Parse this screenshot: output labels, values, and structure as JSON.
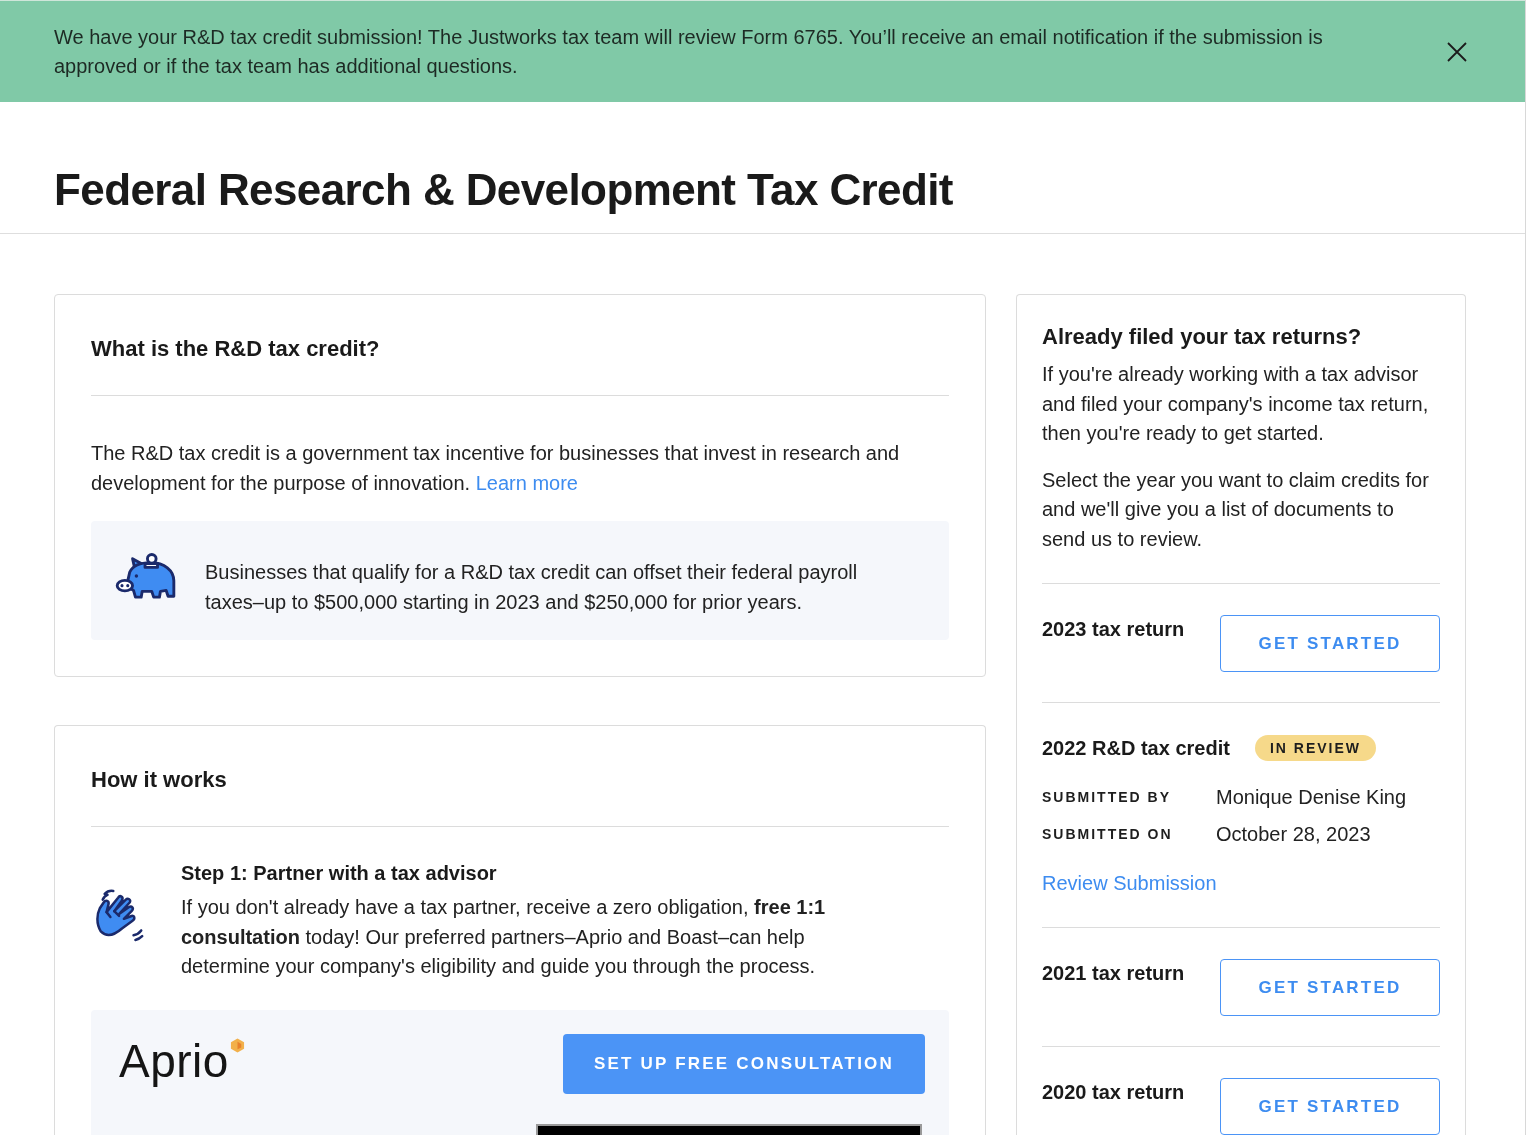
{
  "banner": {
    "message": "We have your R&D tax credit submission! The Justworks tax team will review Form 6765. You’ll receive an email notification if the submission is approved or if the tax team has additional questions."
  },
  "page": {
    "title": "Federal Research & Development Tax Credit"
  },
  "about_card": {
    "title": "What is the R&D tax credit?",
    "body": "The R&D tax credit is a government tax incentive for businesses that invest in research and development for the purpose of innovation.",
    "link": "Learn more",
    "callout": "Businesses that qualify for a R&D tax credit can offset their federal payroll taxes–up to $500,000 starting in 2023 and $250,000 for prior years."
  },
  "how_it_works_card": {
    "title": "How it works",
    "steps": [
      {
        "title": "Step 1: Partner with a tax advisor",
        "body": "If you don't already have a tax partner, receive a zero obligation, **free 1:1 consultation** today! Our preferred partners–Aprio and Boast–can help determine your company's eligibility and guide you through the process."
      }
    ],
    "partner": {
      "logo": "Aprio",
      "button": "SET UP FREE CONSULTATION"
    }
  },
  "filed_card": {
    "title": "Already filed your tax returns?",
    "paragraphs": [
      "If you're already working with a tax advisor and filed your company's income tax return, then you're ready to get started.",
      "Select the year you want to claim credits for and we'll give you a list of documents to send us to review."
    ],
    "years": [
      {
        "kind": "action",
        "title": "2023 tax return",
        "button": "GET STARTED"
      },
      {
        "kind": "submission",
        "title": "2022 R&D tax credit",
        "status": "IN REVIEW",
        "details": [
          {
            "label": "SUBMITTED BY",
            "value": "Monique Denise King"
          },
          {
            "label": "SUBMITTED ON",
            "value": "October 28, 2023"
          }
        ],
        "link": "Review Submission"
      },
      {
        "kind": "action",
        "title": "2021 tax return",
        "button": "GET STARTED"
      },
      {
        "kind": "action",
        "title": "2020 tax return",
        "button": "GET STARTED"
      }
    ]
  }
}
